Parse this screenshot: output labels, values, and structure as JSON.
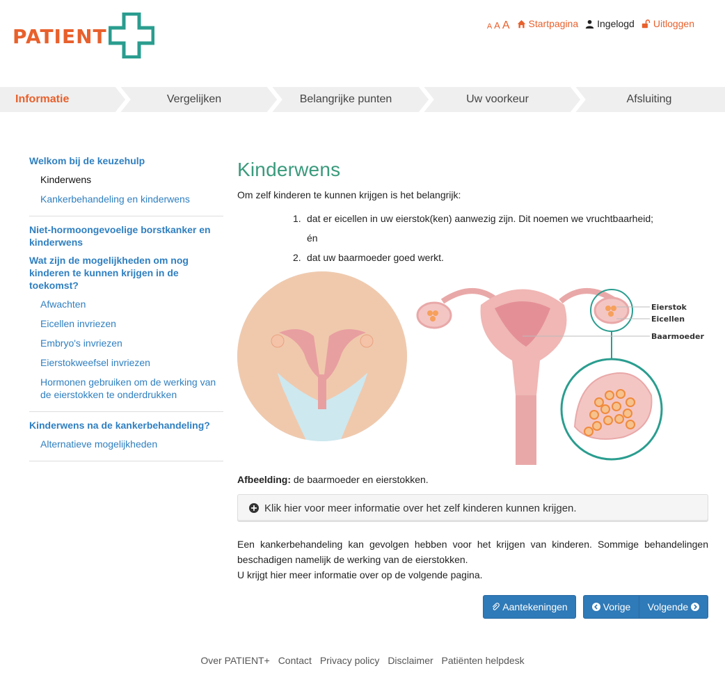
{
  "header": {
    "logo_text": "PATIENT",
    "font_sizes": [
      "A",
      "A",
      "A"
    ],
    "links": {
      "home": "Startpagina",
      "logged_in": "Ingelogd",
      "logout": "Uitloggen"
    }
  },
  "steps": [
    {
      "label": "Informatie",
      "active": true
    },
    {
      "label": "Vergelijken",
      "active": false
    },
    {
      "label": "Belangrijke punten",
      "active": false
    },
    {
      "label": "Uw voorkeur",
      "active": false
    },
    {
      "label": "Afsluiting",
      "active": false
    }
  ],
  "sidebar": {
    "groups": [
      {
        "heading": "Welkom bij de keuzehulp",
        "items": [
          "Kinderwens",
          "Kankerbehandeling en kinderwens"
        ]
      },
      {
        "heading": "Niet-hormoongevoelige borstkanker en kinderwens",
        "items": []
      },
      {
        "heading": "Wat zijn de mogelijkheden om nog kinderen te kunnen krijgen in de toekomst?",
        "items": [
          "Afwachten",
          "Eicellen invriezen",
          "Embryo's invriezen",
          "Eierstokweefsel invriezen",
          "Hormonen gebruiken om de werking van de eierstokken te onderdrukken"
        ]
      },
      {
        "heading": "Kinderwens na de kankerbehandeling?",
        "items": [
          "Alternatieve mogelijkheden"
        ]
      }
    ]
  },
  "main": {
    "title": "Kinderwens",
    "intro": "Om zelf kinderen te kunnen krijgen is het belangrijk:",
    "list": [
      {
        "num": "1.",
        "text": "dat er eicellen in uw eierstok(ken) aanwezig zijn. Dit noemen we vruchtbaarheid;"
      },
      {
        "num": "",
        "text": "én"
      },
      {
        "num": "2.",
        "text": "dat uw baarmoeder goed werkt."
      }
    ],
    "illustration_labels": {
      "ovary": "Eierstok",
      "eggs": "Eicellen",
      "uterus": "Baarmoeder"
    },
    "caption_bold": "Afbeelding:",
    "caption_text": " de baarmoeder en eierstokken.",
    "collapse_label": "Klik hier voor meer informatie over het zelf kinderen kunnen krijgen.",
    "paragraph_line1": "Een kankerbehandeling kan gevolgen hebben voor het krijgen van kinderen. Sommige behandelingen beschadigen namelijk de werking van de eierstokken.",
    "paragraph_line2": "U krijgt hier meer informatie over op de volgende pagina.",
    "buttons": {
      "notes": "Aantekeningen",
      "prev": "Vorige",
      "next": "Volgende"
    }
  },
  "footer": {
    "links": [
      "Over PATIENT+",
      "Contact",
      "Privacy policy",
      "Disclaimer",
      "Patiënten helpdesk"
    ]
  },
  "colors": {
    "orange": "#e8602c",
    "teal": "#2a9d8f",
    "blue": "#2f7fc0",
    "title_green": "#3a9a7c",
    "button_blue": "#2f7ab8"
  }
}
